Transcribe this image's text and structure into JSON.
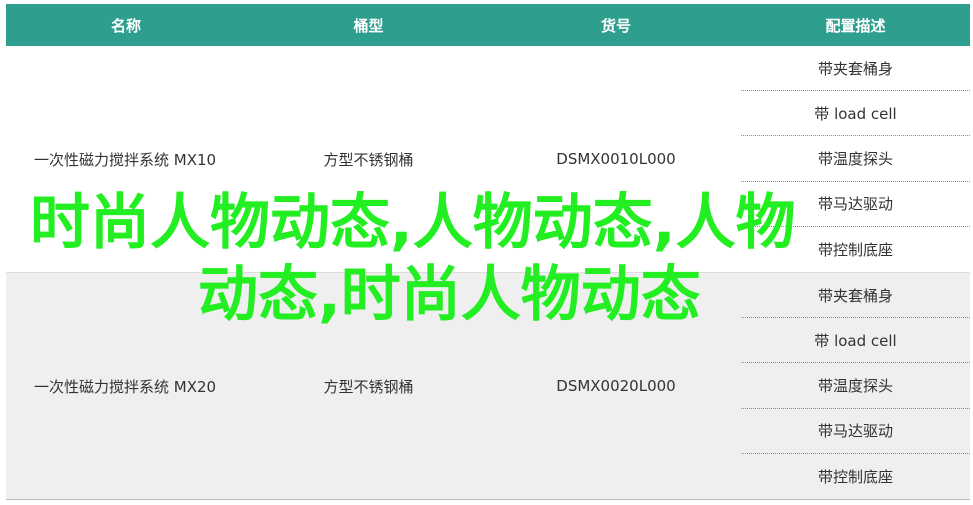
{
  "table": {
    "headers": [
      "名称",
      "桶型",
      "货号",
      "配置描述"
    ],
    "rows": [
      {
        "name": "一次性磁力搅拌系统 MX10",
        "type": "方型不锈钢桶",
        "sku": "DSMX0010L000",
        "config": [
          "带夹套桶身",
          "带 load cell",
          "带温度探头",
          "带马达驱动",
          "带控制底座"
        ]
      },
      {
        "name": "一次性磁力搅拌系统 MX20",
        "type": "方型不锈钢桶",
        "sku": "DSMX0020L000",
        "config": [
          "带夹套桶身",
          "带 load cell",
          "带温度探头",
          "带马达驱动",
          "带控制底座"
        ]
      }
    ]
  },
  "watermark": {
    "line1": "时尚人物动态,人物动态,人物",
    "line2": "动态,时尚人物动态",
    "color": "#22ee22"
  },
  "colors": {
    "header_bg": "#2e9e8f",
    "row_alt_bg": "#efefef"
  }
}
